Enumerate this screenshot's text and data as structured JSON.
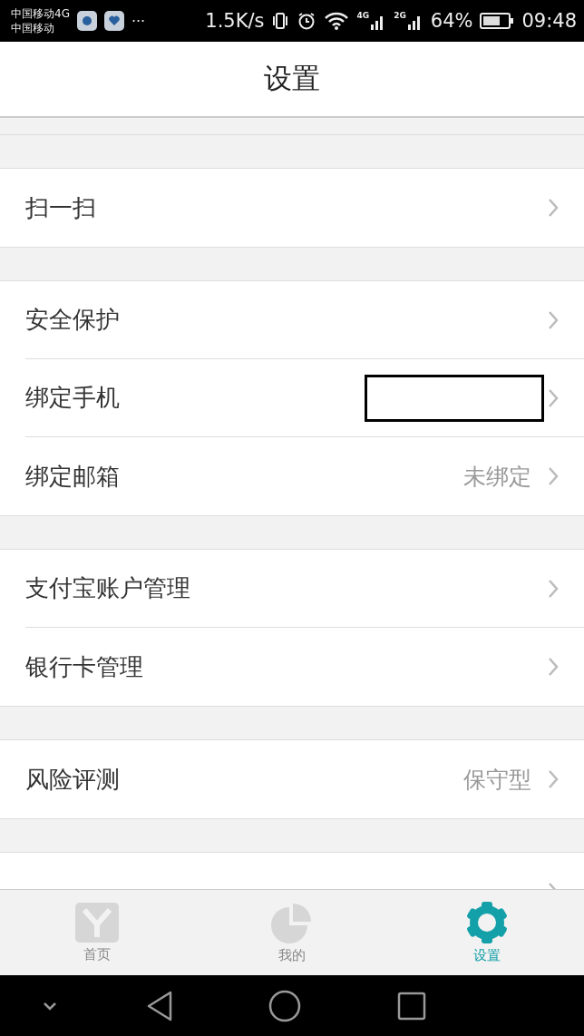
{
  "status_bar": {
    "carrier_1": "中国移动4G",
    "carrier_2": "中国移动",
    "more": "···",
    "speed": "1.5K/s",
    "network_1": "4G",
    "network_2": "2G",
    "battery": "64%",
    "time": "09:48"
  },
  "header": {
    "title": "设置"
  },
  "sections": [
    {
      "items": [
        {
          "kind": "plain",
          "label": "扫一扫"
        }
      ]
    },
    {
      "items": [
        {
          "kind": "plain",
          "label": "安全保护"
        },
        {
          "kind": "redacted",
          "label": "绑定手机"
        },
        {
          "kind": "value",
          "label": "绑定邮箱",
          "value": "未绑定"
        }
      ]
    },
    {
      "items": [
        {
          "kind": "plain",
          "label": "支付宝账户管理"
        },
        {
          "kind": "plain",
          "label": "银行卡管理"
        }
      ]
    },
    {
      "items": [
        {
          "kind": "value",
          "label": "风险评测",
          "value": "保守型"
        }
      ]
    },
    {
      "items": [
        {
          "kind": "plain"
        }
      ]
    }
  ],
  "tabs": [
    {
      "kind": "home",
      "label": "首页",
      "selected": false
    },
    {
      "kind": "mine",
      "label": "我的",
      "selected": false
    },
    {
      "kind": "settings",
      "label": "设置",
      "selected": true
    }
  ]
}
